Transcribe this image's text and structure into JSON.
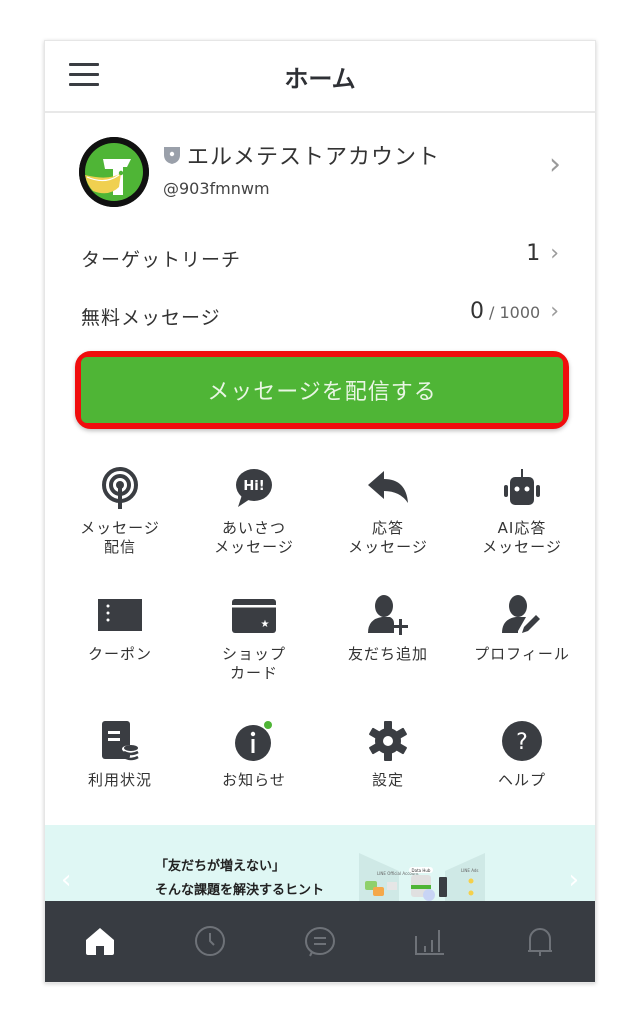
{
  "header": {
    "title": "ホーム",
    "menu_icon": "hamburger-menu-icon"
  },
  "account": {
    "name": "エルメテストアカウント",
    "id": "@903fmnwm",
    "badge_icon": "shield-badge-icon",
    "chevron": "›"
  },
  "stats": [
    {
      "label": "ターゲットリーチ",
      "value": "1",
      "max": "",
      "chevron": "›"
    },
    {
      "label": "無料メッセージ",
      "value": "0",
      "max": "/ 1000",
      "chevron": "›"
    }
  ],
  "send_button": {
    "label": "メッセージを配信する",
    "color": "#4fb536",
    "highlight_color": "#f00d0d"
  },
  "menu_grid": [
    {
      "label": "メッセージ\n配信",
      "icon": "broadcast-icon"
    },
    {
      "label": "あいさつ\nメッセージ",
      "icon": "hi-speech-bubble-icon",
      "icon_text": "Hi!"
    },
    {
      "label": "応答\nメッセージ",
      "icon": "reply-arrow-icon"
    },
    {
      "label": "AI応答\nメッセージ",
      "icon": "robot-icon"
    },
    {
      "label": "クーポン",
      "icon": "coupon-icon"
    },
    {
      "label": "ショップ\nカード",
      "icon": "shop-card-icon"
    },
    {
      "label": "友だち追加",
      "icon": "add-friend-icon"
    },
    {
      "label": "プロフィール",
      "icon": "edit-profile-icon"
    },
    {
      "label": "利用状況",
      "icon": "usage-icon"
    },
    {
      "label": "お知らせ",
      "icon": "info-icon",
      "has_notification": true
    },
    {
      "label": "設定",
      "icon": "gear-icon"
    },
    {
      "label": "ヘルプ",
      "icon": "help-icon",
      "icon_text": "?"
    }
  ],
  "banner": {
    "line1": "「友だちが増えない」",
    "line2": "そんな課題を解決するヒント",
    "image_labels": [
      "LINE Official Account",
      "Data Hub",
      "LINE Ads"
    ],
    "prev": "‹",
    "next": "›"
  },
  "bottom_nav": [
    {
      "name": "home",
      "icon": "home-icon",
      "active": true
    },
    {
      "name": "timeline",
      "icon": "clock-icon",
      "active": false
    },
    {
      "name": "chat",
      "icon": "chat-bubble-icon",
      "active": false
    },
    {
      "name": "analytics",
      "icon": "bar-chart-icon",
      "active": false
    },
    {
      "name": "notifications",
      "icon": "bell-icon",
      "active": false
    }
  ],
  "colors": {
    "icon_dark": "#3a3d42",
    "nav_bg": "#383c42",
    "notification_dot": "#4fb536",
    "banner_bg": "#dff7f4"
  }
}
